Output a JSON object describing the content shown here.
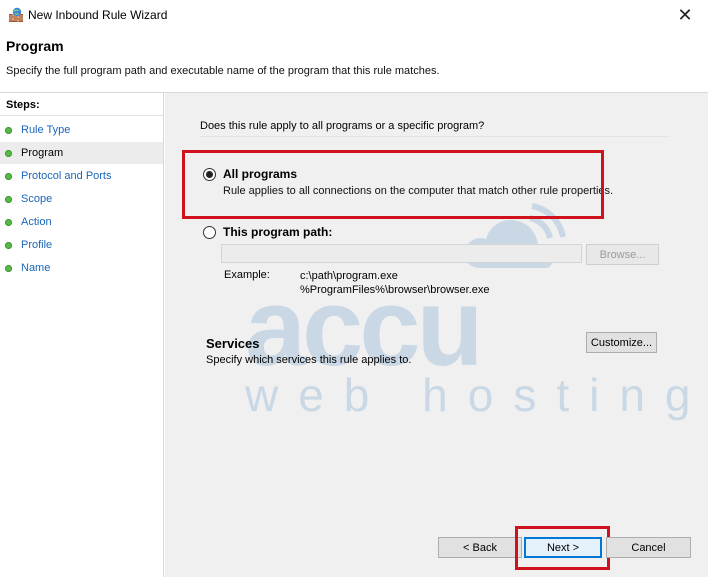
{
  "window": {
    "title": "New Inbound Rule Wizard",
    "close_glyph": "✕"
  },
  "header": {
    "title": "Program",
    "subtitle": "Specify the full program path and executable name of the program that this rule matches."
  },
  "steps": {
    "label": "Steps:",
    "items": [
      {
        "label": "Rule Type",
        "current": false
      },
      {
        "label": "Program",
        "current": true
      },
      {
        "label": "Protocol and Ports",
        "current": false
      },
      {
        "label": "Scope",
        "current": false
      },
      {
        "label": "Action",
        "current": false
      },
      {
        "label": "Profile",
        "current": false
      },
      {
        "label": "Name",
        "current": false
      }
    ]
  },
  "content": {
    "question": "Does this rule apply to all programs or a specific program?",
    "all_programs": {
      "label": "All programs",
      "description": "Rule applies to all connections on the computer that match other rule properties.",
      "selected": true
    },
    "this_program": {
      "label": "This program path:",
      "value": "",
      "selected": false
    },
    "browse_label": "Browse...",
    "example_label": "Example:",
    "example_line1": "c:\\path\\program.exe",
    "example_line2": "%ProgramFiles%\\browser\\browser.exe",
    "services_title": "Services",
    "services_desc": "Specify which services this rule applies to.",
    "customize_label": "Customize..."
  },
  "footer": {
    "back_label": "< Back",
    "next_label": "Next >",
    "cancel_label": "Cancel"
  },
  "watermark": {
    "line1": "accu",
    "line2": "web hosting"
  },
  "colors": {
    "highlight": "#d0121c",
    "link": "#1b66b8",
    "step_dot": "#58b848",
    "accent": "#0078d7"
  }
}
